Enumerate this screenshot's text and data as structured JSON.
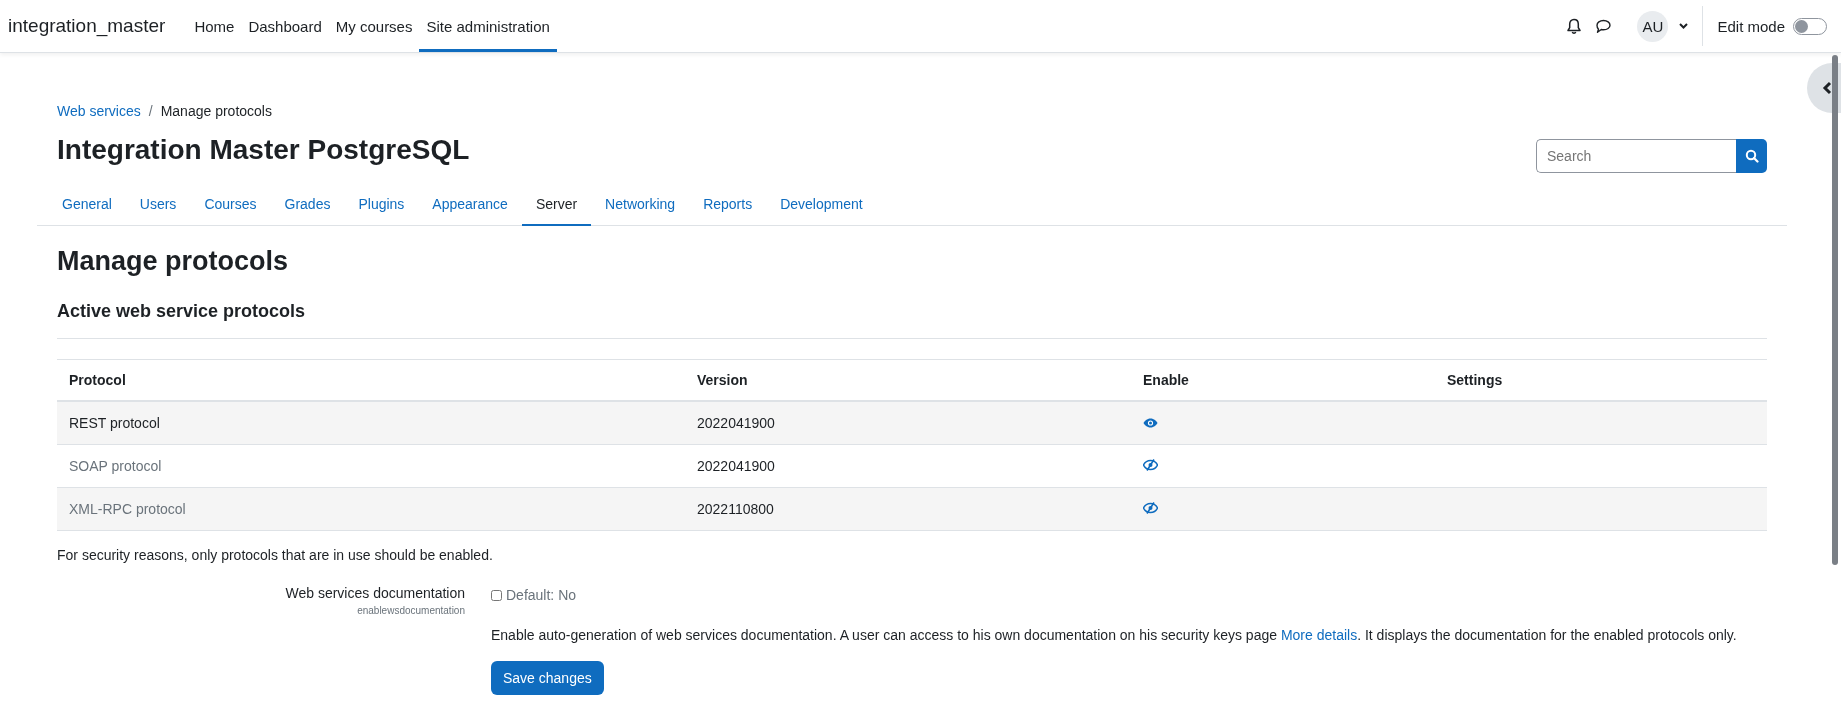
{
  "navbar": {
    "site_name": "integration_master",
    "items": [
      {
        "label": "Home",
        "selected": false
      },
      {
        "label": "Dashboard",
        "selected": false
      },
      {
        "label": "My courses",
        "selected": false
      },
      {
        "label": "Site administration",
        "selected": true
      }
    ],
    "avatar": "AU",
    "edit_mode": {
      "label": "Edit mode",
      "on": false
    }
  },
  "breadcrumb_separator": "/",
  "breadcrumb": [
    {
      "label": "Web services",
      "kind": "link"
    },
    {
      "label": "Manage protocols",
      "kind": "current"
    }
  ],
  "page_title": "Integration Master PostgreSQL",
  "search": {
    "placeholder": "Search"
  },
  "tabs": [
    {
      "label": "General",
      "selected": false
    },
    {
      "label": "Users",
      "selected": false
    },
    {
      "label": "Courses",
      "selected": false
    },
    {
      "label": "Grades",
      "selected": false
    },
    {
      "label": "Plugins",
      "selected": false
    },
    {
      "label": "Appearance",
      "selected": false
    },
    {
      "label": "Server",
      "selected": true
    },
    {
      "label": "Networking",
      "selected": false
    },
    {
      "label": "Reports",
      "selected": false
    },
    {
      "label": "Development",
      "selected": false
    }
  ],
  "heading": "Manage protocols",
  "subheading": "Active web service protocols",
  "table": {
    "columns": [
      "Protocol",
      "Version",
      "Enable",
      "Settings"
    ],
    "rows": [
      {
        "protocol": "REST protocol",
        "version": "2022041900",
        "enabled": true
      },
      {
        "protocol": "SOAP protocol",
        "version": "2022041900",
        "enabled": false
      },
      {
        "protocol": "XML-RPC protocol",
        "version": "2022110800",
        "enabled": false
      }
    ]
  },
  "note": "For security reasons, only protocols that are in use should be enabled.",
  "setting": {
    "label": "Web services documentation",
    "name": "enablewsdocumentation",
    "checked": false,
    "default": "Default: No",
    "description_before": "Enable auto-generation of web services documentation. A user can access to his own documentation on his security keys page",
    "link": "More details",
    "description_after": ". It displays the documentation for the enabled protocols only."
  },
  "save_button": "Save changes"
}
